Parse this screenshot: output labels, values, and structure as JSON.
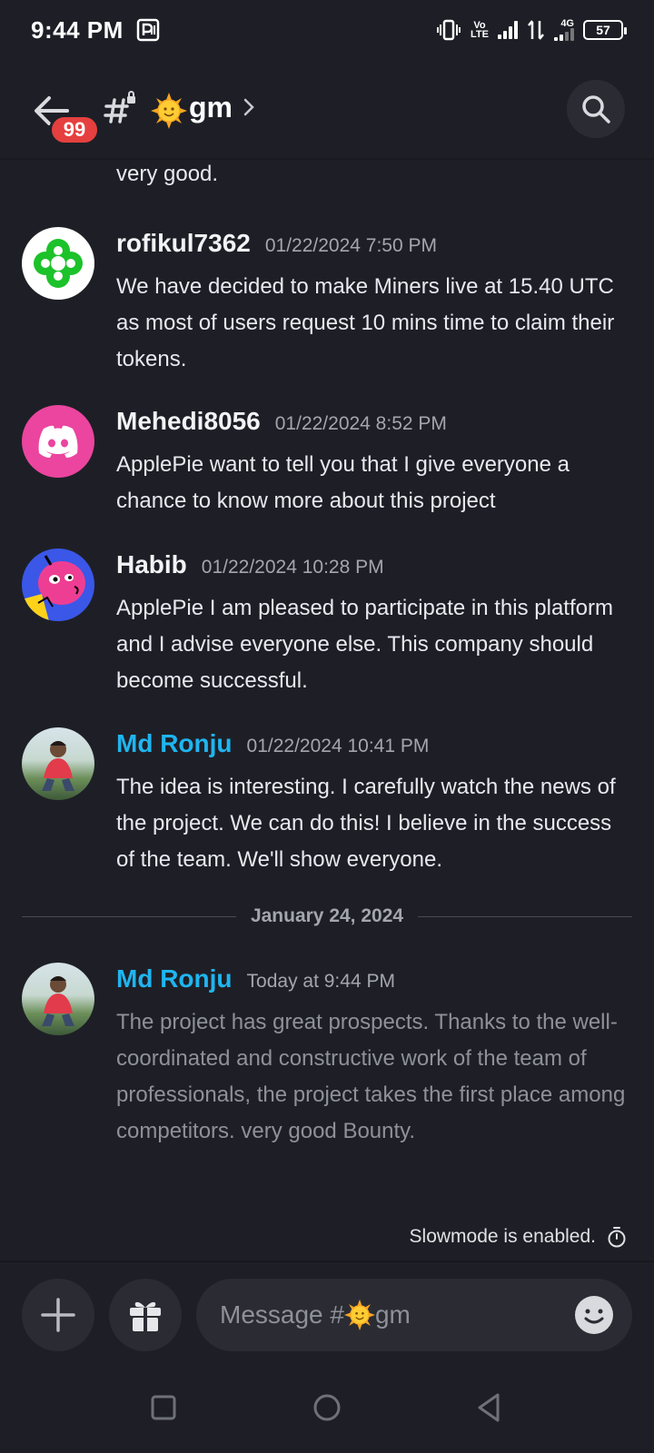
{
  "status_bar": {
    "time": "9:44 PM",
    "network_label_top": "Vo",
    "network_label_bottom": "LTE",
    "data_label": "4G",
    "battery": "57"
  },
  "header": {
    "unread_badge": "99",
    "channel_name": "gm"
  },
  "messages": {
    "continuation_text": "very good.",
    "items": [
      {
        "author": "rofikul7362",
        "timestamp": "01/22/2024 7:50 PM",
        "text": "We have decided to make Miners live at 15.40 UTC as most of users request 10 mins time to claim their tokens."
      },
      {
        "author": "Mehedi8056",
        "timestamp": "01/22/2024 8:52 PM",
        "text": "ApplePie want to tell you that I give everyone a chance to know more about this project"
      },
      {
        "author": "Habib",
        "timestamp": "01/22/2024 10:28 PM",
        "text": "ApplePie I am pleased to participate in this platform and I advise everyone else. This company should become successful."
      },
      {
        "author": "Md Ronju",
        "timestamp": "01/22/2024 10:41 PM",
        "text": "The idea is interesting. I carefully watch the news of the project. We can do this! I believe in the success of the team. We'll show everyone."
      }
    ],
    "date_divider": "January 24, 2024",
    "latest": {
      "author": "Md Ronju",
      "timestamp": "Today at 9:44 PM",
      "text": "The project has great prospects. Thanks to the well-coordinated and constructive work of the team of professionals, the project takes the first place among competitors. very good Bounty."
    }
  },
  "slowmode_text": "Slowmode is enabled.",
  "composer": {
    "placeholder_prefix": "Message #",
    "placeholder_channel": "gm"
  },
  "colors": {
    "background": "#1e1f26",
    "accent_teal": "#1fb5f0",
    "badge_red": "#e5403f",
    "discord_pink": "#eb459f"
  }
}
